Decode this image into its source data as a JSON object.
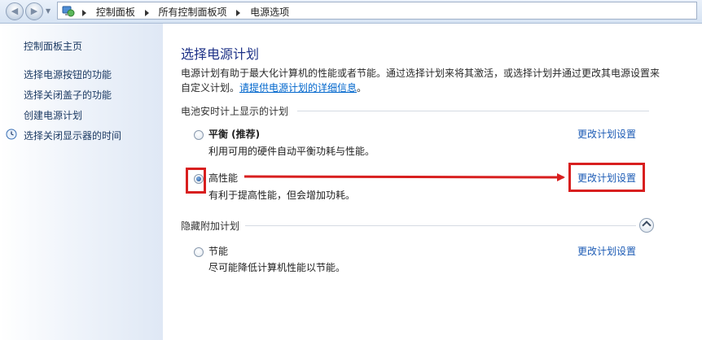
{
  "breadcrumb": [
    "控制面板",
    "所有控制面板项",
    "电源选项"
  ],
  "sidebar": {
    "home": "控制面板主页",
    "links": [
      "选择电源按钮的功能",
      "选择关闭盖子的功能",
      "创建电源计划",
      "选择关闭显示器的时间"
    ]
  },
  "main": {
    "title": "选择电源计划",
    "description": "电源计划有助于最大化计算机的性能或者节能。通过选择计划来将其激活，或选择计划并通过更改其电源设置来自定义计划。",
    "description_link": "请提供电源计划的详细信息",
    "description_end": "。",
    "battery_group": "电池安时计上显示的计划",
    "hidden_group": "隐藏附加计划",
    "plans": [
      {
        "name": "平衡 (推荐)",
        "desc": "利用可用的硬件自动平衡功耗与性能。",
        "selected": false,
        "change": "更改计划设置"
      },
      {
        "name": "高性能",
        "desc": "有利于提高性能，但会增加功耗。",
        "selected": true,
        "change": "更改计划设置"
      },
      {
        "name": "节能",
        "desc": "尽可能降低计算机性能以节能。",
        "selected": false,
        "change": "更改计划设置"
      }
    ]
  },
  "colors": {
    "annotation": "#d81f1f",
    "link": "#1c5bb5",
    "title": "#1e3287"
  }
}
